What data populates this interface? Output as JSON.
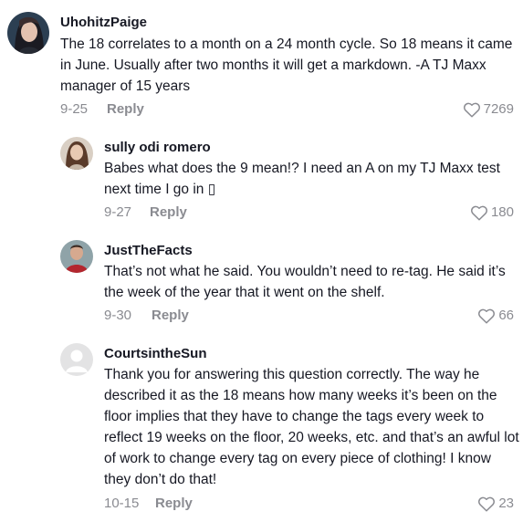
{
  "comments": [
    {
      "username": "UhohitzPaige",
      "text": "The 18 correlates to a month on a 24 month cycle. So 18 means it came in June. Usually after two months it will get a markdown. -A TJ Maxx manager of 15 years",
      "date": "9-25",
      "reply_label": "Reply",
      "likes": "7269",
      "avatar_icon": "user-avatar"
    },
    {
      "username": "sully odi romero",
      "text": "Babes what does the 9 mean!? I need an A on my TJ Maxx test next time I go in ▯",
      "date": "9-27",
      "reply_label": "Reply",
      "likes": "180",
      "avatar_icon": "user-avatar"
    },
    {
      "username": "JustTheFacts",
      "text": "That’s not what he said. You wouldn’t need to re-tag. He said it’s the week of the year that it went on the shelf.",
      "date": "9-30",
      "reply_label": "Reply",
      "likes": "66",
      "avatar_icon": "user-avatar"
    },
    {
      "username": "CourtsintheSun",
      "text": "Thank you for answering this question correctly. The way he described it as the 18 means how many weeks it’s been on the floor implies that they have to change the tags every week to reflect 19 weeks on the floor, 20 weeks, etc. and that’s an awful lot of work to change every tag on every piece of clothing! I know they don’t do that!",
      "date": "10-15",
      "reply_label": "Reply",
      "likes": "23",
      "avatar_icon": "default-avatar"
    }
  ],
  "colors": {
    "text": "#161823",
    "muted": "#8a8b91",
    "background": "#ffffff"
  },
  "icons": {
    "like": "heart-outline-icon"
  }
}
